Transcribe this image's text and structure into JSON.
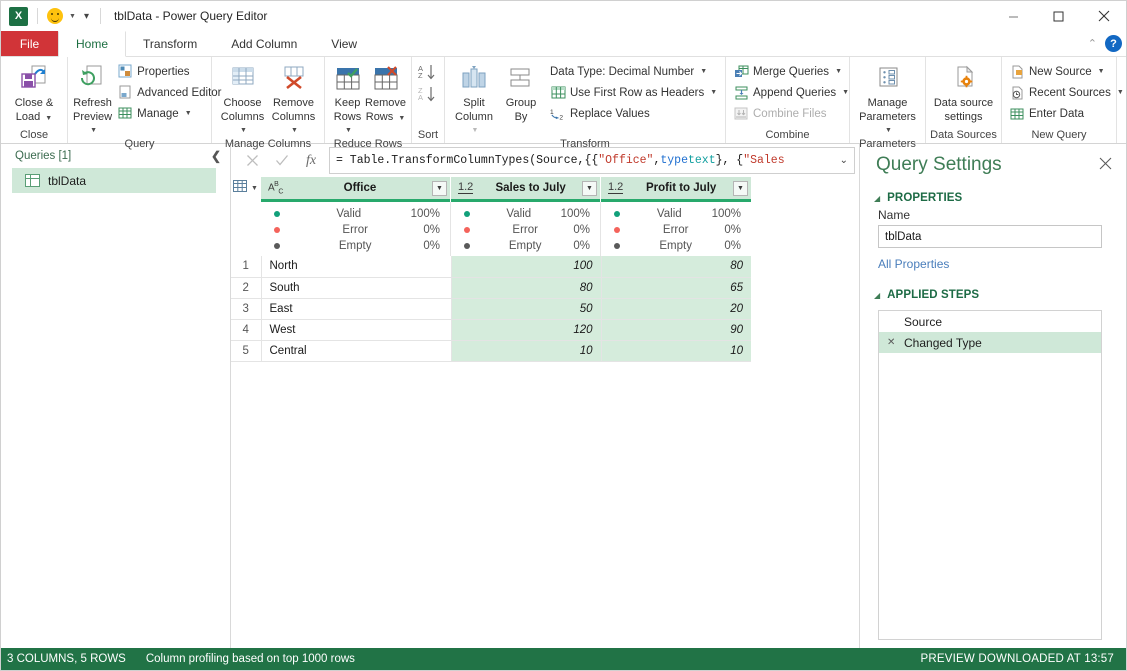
{
  "titlebar": {
    "app_icon": "excel-icon",
    "qat_smiley": "smiley-icon",
    "title": "tblData - Power Query Editor",
    "minimize": "minimize-icon",
    "maximize": "maximize-icon",
    "close": "close-icon"
  },
  "ribbon_tabs": {
    "file": "File",
    "tabs": [
      {
        "label": "Home",
        "active": true
      },
      {
        "label": "Transform",
        "active": false
      },
      {
        "label": "Add Column",
        "active": false
      },
      {
        "label": "View",
        "active": false
      }
    ],
    "help": "?"
  },
  "ribbon": {
    "groups": [
      {
        "name": "Close",
        "label": "Close",
        "big_buttons": [
          {
            "label_line1": "Close &",
            "label_line2": "Load",
            "has_caret": true
          }
        ]
      },
      {
        "name": "Query",
        "label": "Query",
        "big_buttons": [
          {
            "label_line1": "Refresh",
            "label_line2": "Preview",
            "has_caret": true
          }
        ],
        "small_buttons": [
          {
            "label": "Properties",
            "has_caret": false,
            "disabled": false
          },
          {
            "label": "Advanced Editor",
            "has_caret": false,
            "disabled": false
          },
          {
            "label": "Manage",
            "has_caret": true,
            "disabled": false
          }
        ]
      },
      {
        "name": "Manage Columns",
        "label": "Manage Columns",
        "big_buttons": [
          {
            "label_line1": "Choose",
            "label_line2": "Columns",
            "has_caret": true
          },
          {
            "label_line1": "Remove",
            "label_line2": "Columns",
            "has_caret": true
          }
        ]
      },
      {
        "name": "Reduce Rows",
        "label": "Reduce Rows",
        "big_buttons": [
          {
            "label_line1": "Keep",
            "label_line2": "Rows",
            "has_caret": true
          },
          {
            "label_line1": "Remove",
            "label_line2": "Rows",
            "has_caret": true
          }
        ]
      },
      {
        "name": "Sort",
        "label": "Sort",
        "sort_asc": "sort-ascending-icon",
        "sort_desc": "sort-descending-icon"
      },
      {
        "name": "Transform",
        "label": "Transform",
        "big_buttons": [
          {
            "label_line1": "Split",
            "label_line2": "Column",
            "has_caret": true
          },
          {
            "label_line1": "Group",
            "label_line2": "By",
            "has_caret": false
          }
        ],
        "small_buttons": [
          {
            "label": "Data Type: Decimal Number",
            "has_caret": true,
            "disabled": false
          },
          {
            "label": "Use First Row as Headers",
            "has_caret": true,
            "disabled": false
          },
          {
            "label": "Replace Values",
            "has_caret": false,
            "disabled": false
          }
        ]
      },
      {
        "name": "Combine",
        "label": "Combine",
        "small_buttons": [
          {
            "label": "Merge Queries",
            "has_caret": true,
            "disabled": false
          },
          {
            "label": "Append Queries",
            "has_caret": true,
            "disabled": false
          },
          {
            "label": "Combine Files",
            "has_caret": false,
            "disabled": true
          }
        ]
      },
      {
        "name": "Parameters",
        "label": "Parameters",
        "big_buttons": [
          {
            "label_line1": "Manage",
            "label_line2": "Parameters",
            "has_caret": true
          }
        ]
      },
      {
        "name": "Data Sources",
        "label": "Data Sources",
        "big_buttons": [
          {
            "label_line1": "Data source",
            "label_line2": "settings",
            "has_caret": false
          }
        ]
      },
      {
        "name": "New Query",
        "label": "New Query",
        "small_buttons": [
          {
            "label": "New Source",
            "has_caret": true,
            "disabled": false
          },
          {
            "label": "Recent Sources",
            "has_caret": true,
            "disabled": false
          },
          {
            "label": "Enter Data",
            "has_caret": false,
            "disabled": false
          }
        ]
      }
    ]
  },
  "queries_pane": {
    "header": "Queries [1]",
    "collapse": "collapse-icon",
    "items": [
      {
        "label": "tblData",
        "selected": true
      }
    ]
  },
  "formula_bar": {
    "cancel": "cancel-icon",
    "accept": "accept-icon",
    "fx": "fx",
    "formula_prefix": "= Table.TransformColumnTypes(Source,{{",
    "formula_tokens": [
      {
        "text": "= Table.TransformColumnTypes(Source,{{",
        "style": "plain"
      },
      {
        "text": "\"Office\"",
        "style": "string"
      },
      {
        "text": ", ",
        "style": "plain"
      },
      {
        "text": "type",
        "style": "keyword"
      },
      {
        "text": " ",
        "style": "plain"
      },
      {
        "text": "text",
        "style": "type"
      },
      {
        "text": "}, {",
        "style": "plain"
      },
      {
        "text": "\"Sales",
        "style": "string"
      }
    ],
    "expand": "chevron-down-icon"
  },
  "grid": {
    "columns": [
      {
        "name": "Office",
        "type_icon": "ABC",
        "type_kind": "text",
        "quality": [
          {
            "label": "Valid",
            "value": "100%",
            "dot": "valid"
          },
          {
            "label": "Error",
            "value": "0%",
            "dot": "error"
          },
          {
            "label": "Empty",
            "value": "0%",
            "dot": "empty"
          }
        ]
      },
      {
        "name": "Sales to July",
        "type_icon": "1.2",
        "type_kind": "number",
        "quality": [
          {
            "label": "Valid",
            "value": "100%",
            "dot": "valid"
          },
          {
            "label": "Error",
            "value": "0%",
            "dot": "error"
          },
          {
            "label": "Empty",
            "value": "0%",
            "dot": "empty"
          }
        ]
      },
      {
        "name": "Profit to July",
        "type_icon": "1.2",
        "type_kind": "number",
        "quality": [
          {
            "label": "Valid",
            "value": "100%",
            "dot": "valid"
          },
          {
            "label": "Error",
            "value": "0%",
            "dot": "error"
          },
          {
            "label": "Empty",
            "value": "0%",
            "dot": "empty"
          }
        ]
      }
    ],
    "rows": [
      {
        "num": "1",
        "office": "North",
        "sales": "100",
        "profit": "80"
      },
      {
        "num": "2",
        "office": "South",
        "sales": "80",
        "profit": "65"
      },
      {
        "num": "3",
        "office": "East",
        "sales": "50",
        "profit": "20"
      },
      {
        "num": "4",
        "office": "West",
        "sales": "120",
        "profit": "90"
      },
      {
        "num": "5",
        "office": "Central",
        "sales": "10",
        "profit": "10"
      }
    ]
  },
  "settings": {
    "title": "Query Settings",
    "close": "close-icon",
    "properties_section": "PROPERTIES",
    "name_label": "Name",
    "name_value": "tblData",
    "all_properties": "All Properties",
    "applied_steps_section": "APPLIED STEPS",
    "steps": [
      {
        "label": "Source",
        "selected": false,
        "has_delete": false
      },
      {
        "label": "Changed Type",
        "selected": true,
        "has_delete": true
      }
    ]
  },
  "statusbar": {
    "dimensions": "3 COLUMNS, 5 ROWS",
    "profiling": "Column profiling based on top 1000 rows",
    "preview": "PREVIEW DOWNLOADED AT 13:57"
  },
  "colors": {
    "accent_green": "#217346",
    "file_red": "#d13438",
    "selection_green": "#cfe8d8",
    "column_green": "#d5ecdc",
    "quality_bar": "#28a96c"
  }
}
